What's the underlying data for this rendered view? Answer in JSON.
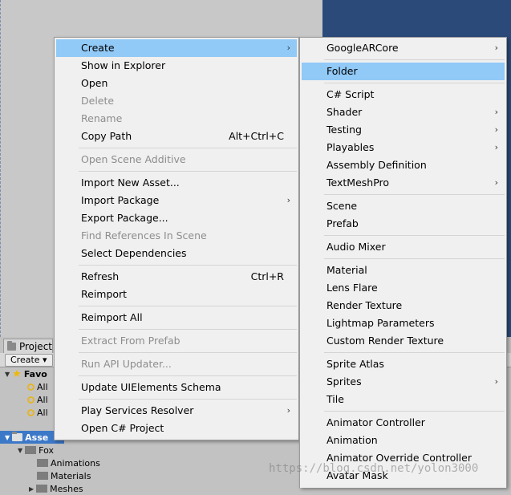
{
  "project": {
    "tab_label": "Project",
    "create_button": "Create",
    "favorites_label": "Favo",
    "favorite_items": [
      "All",
      "All",
      "All"
    ],
    "assets_label": "Asse",
    "fox_label": "Fox",
    "animations_label": "Animations",
    "materials_label": "Materials",
    "meshes_label": "Meshes"
  },
  "context_menu": {
    "items": [
      {
        "label": "Create",
        "submenu": true,
        "highlighted": true
      },
      {
        "label": "Show in Explorer"
      },
      {
        "label": "Open"
      },
      {
        "label": "Delete",
        "disabled": true
      },
      {
        "label": "Rename",
        "disabled": true
      },
      {
        "label": "Copy Path",
        "shortcut": "Alt+Ctrl+C"
      },
      {
        "label": "Open Scene Additive",
        "disabled": true
      },
      {
        "label": "Import New Asset..."
      },
      {
        "label": "Import Package",
        "submenu": true
      },
      {
        "label": "Export Package..."
      },
      {
        "label": "Find References In Scene",
        "disabled": true
      },
      {
        "label": "Select Dependencies"
      },
      {
        "label": "Refresh",
        "shortcut": "Ctrl+R"
      },
      {
        "label": "Reimport"
      },
      {
        "label": "Reimport All"
      },
      {
        "label": "Extract From Prefab",
        "disabled": true
      },
      {
        "label": "Run API Updater...",
        "disabled": true
      },
      {
        "label": "Update UIElements Schema"
      },
      {
        "label": "Play Services Resolver",
        "submenu": true
      },
      {
        "label": "Open C# Project"
      }
    ]
  },
  "create_submenu": {
    "items": [
      {
        "label": "GoogleARCore",
        "submenu": true
      },
      {
        "label": "Folder",
        "highlighted": true
      },
      {
        "label": "C# Script"
      },
      {
        "label": "Shader",
        "submenu": true
      },
      {
        "label": "Testing",
        "submenu": true
      },
      {
        "label": "Playables",
        "submenu": true
      },
      {
        "label": "Assembly Definition"
      },
      {
        "label": "TextMeshPro",
        "submenu": true
      },
      {
        "label": "Scene"
      },
      {
        "label": "Prefab"
      },
      {
        "label": "Audio Mixer"
      },
      {
        "label": "Material"
      },
      {
        "label": "Lens Flare"
      },
      {
        "label": "Render Texture"
      },
      {
        "label": "Lightmap Parameters"
      },
      {
        "label": "Custom Render Texture"
      },
      {
        "label": "Sprite Atlas"
      },
      {
        "label": "Sprites",
        "submenu": true
      },
      {
        "label": "Tile"
      },
      {
        "label": "Animator Controller"
      },
      {
        "label": "Animation"
      },
      {
        "label": "Animator Override Controller"
      },
      {
        "label": "Avatar Mask"
      }
    ]
  },
  "watermark": "https://blog.csdn.net/yolon3000"
}
